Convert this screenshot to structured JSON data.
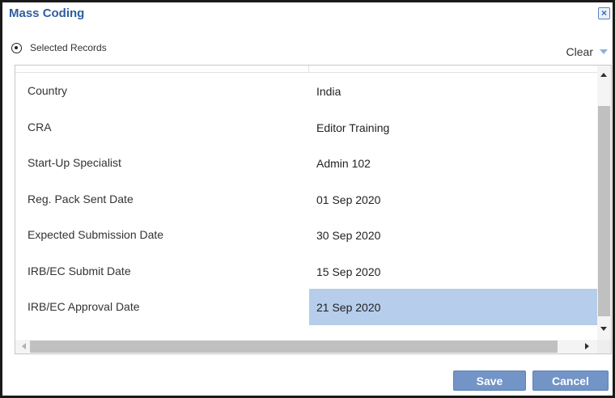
{
  "dialog": {
    "title": "Mass Coding",
    "close_icon": "close-icon"
  },
  "scope": {
    "radio_label": "Selected Records",
    "selected": true
  },
  "clear": {
    "label": "Clear",
    "icon": "caret-down-icon"
  },
  "rows": [
    {
      "label": "Country",
      "value": "India"
    },
    {
      "label": "CRA",
      "value": "Editor Training"
    },
    {
      "label": "Start-Up Specialist",
      "value": "Admin 102"
    },
    {
      "label": "Reg. Pack Sent Date",
      "value": "01 Sep 2020"
    },
    {
      "label": "Expected Submission Date",
      "value": "30 Sep 2020"
    },
    {
      "label": "IRB/EC Submit Date",
      "value": "15 Sep 2020"
    },
    {
      "label": "IRB/EC Approval Date",
      "value": "21 Sep 2020"
    }
  ],
  "selected_row": 6,
  "buttons": {
    "save": "Save",
    "cancel": "Cancel"
  },
  "colors": {
    "title": "#2f5e9e",
    "button_bg": "#7394c6",
    "selected_cell": "#b6cdeb"
  }
}
